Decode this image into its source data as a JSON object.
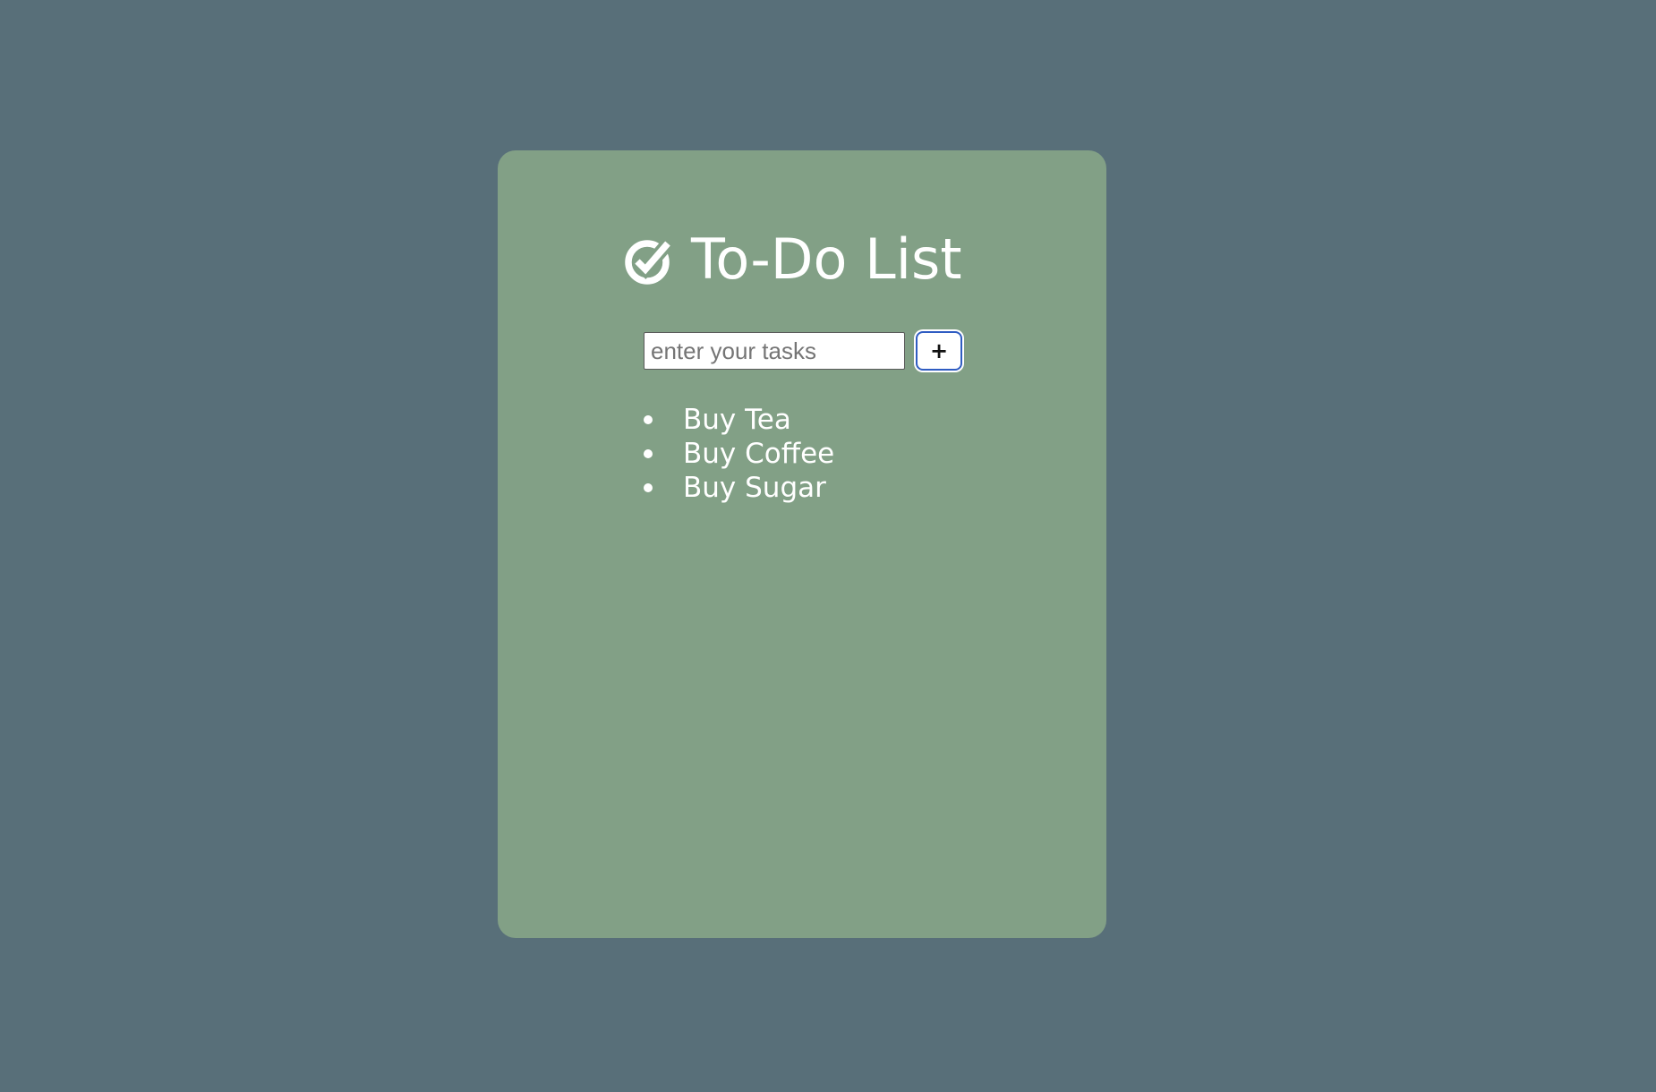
{
  "app": {
    "title": "To-Do List",
    "title_icon": "check-circle-icon"
  },
  "input": {
    "value": "",
    "placeholder": "enter your tasks"
  },
  "add_button": {
    "label": "+"
  },
  "tasks": [
    {
      "label": "Buy Tea"
    },
    {
      "label": "Buy Coffee"
    },
    {
      "label": "Buy Sugar"
    }
  ],
  "colors": {
    "page_background": "#586f79",
    "card_background": "#82a086",
    "text": "#ffffff",
    "button_border": "#2f5cc2"
  }
}
